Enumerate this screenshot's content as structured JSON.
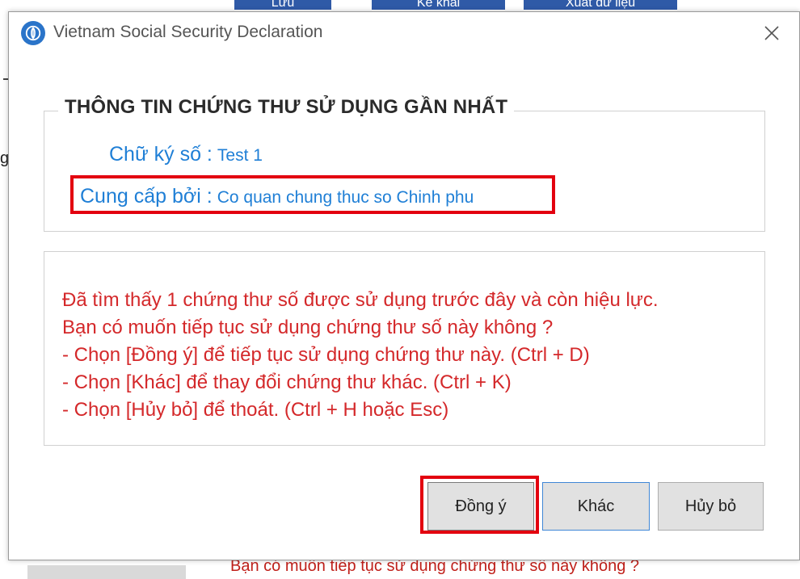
{
  "background": {
    "toolbar_buttons": [
      "Lưu",
      "Kê khai",
      "Xuất dữ liệu"
    ],
    "left_fragment_text": "g",
    "bottom_text": "Bạn có muốn tiếp tục sử dụng chứng thư số này không ?"
  },
  "dialog": {
    "title": "Vietnam Social Security Declaration",
    "app_icon": "vss-logo-icon",
    "close_icon": "close-icon",
    "group_title": "THÔNG TIN CHỨNG THƯ SỬ DỤNG GẦN NHẤT",
    "signature_label": "Chữ ký số :",
    "signature_value": "Test 1",
    "provider_label": "Cung cấp bởi :",
    "provider_value": "Co quan chung thuc so Chinh phu",
    "message_lines": [
      "Đã tìm thấy 1 chứng thư số được sử dụng trước đây và còn hiệu lực.",
      "Bạn có muốn tiếp tục sử dụng chứng thư số này không ?",
      "- Chọn [Đồng ý] để tiếp tục sử dụng chứng thư này.  (Ctrl + D)",
      "- Chọn [Khác] để thay đổi chứng thư khác. (Ctrl + K)",
      "- Chọn [Hủy bỏ] để thoát. (Ctrl + H hoặc Esc)"
    ],
    "buttons": {
      "agree": "Đồng ý",
      "other": "Khác",
      "cancel": "Hủy bỏ"
    },
    "colors": {
      "info_text": "#1f7fd6",
      "message_text": "#d4282a",
      "highlight": "#e3000f"
    }
  }
}
